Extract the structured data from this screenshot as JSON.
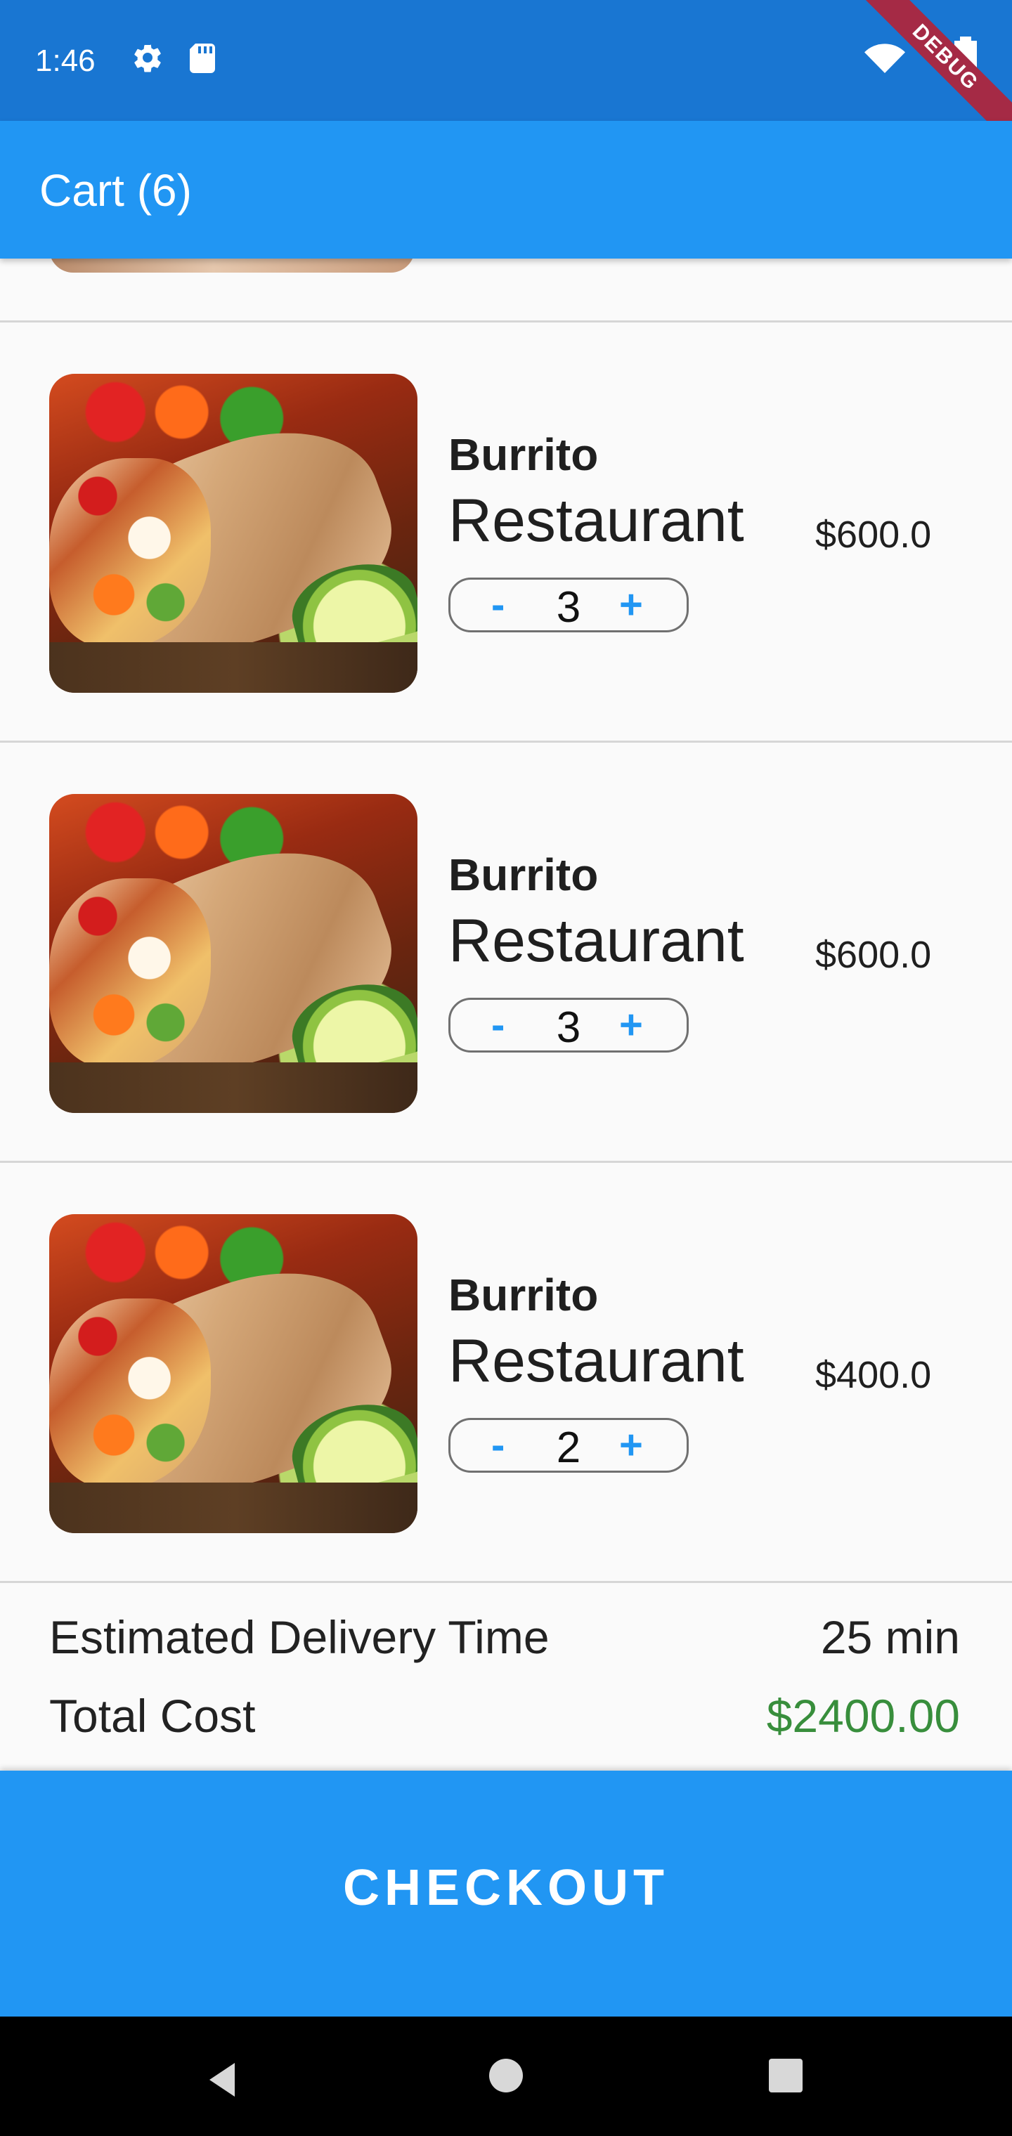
{
  "status_bar": {
    "time": "1:46",
    "debug_label": "DEBUG",
    "icons": [
      "gear-icon",
      "sd-card-icon",
      "wifi-icon",
      "signal-icon",
      "battery-icon"
    ]
  },
  "app_bar": {
    "title": "Cart (6)"
  },
  "cart": {
    "items": [
      {
        "category": "Burrito",
        "restaurant": "Restaurant",
        "price": "$600.0",
        "minus_label": "-",
        "quantity": "3",
        "plus_label": "+"
      },
      {
        "category": "Burrito",
        "restaurant": "Restaurant",
        "price": "$600.0",
        "minus_label": "-",
        "quantity": "3",
        "plus_label": "+"
      },
      {
        "category": "Burrito",
        "restaurant": "Restaurant",
        "price": "$400.0",
        "minus_label": "-",
        "quantity": "2",
        "plus_label": "+"
      }
    ]
  },
  "summary": {
    "delivery_label": "Estimated Delivery Time",
    "delivery_value": "25 min",
    "total_label": "Total Cost",
    "total_value": "$2400.00"
  },
  "checkout": {
    "label": "CHECKOUT"
  },
  "colors": {
    "status_bar": "#1976d2",
    "primary": "#2196f3",
    "total_green": "#388e3c",
    "debug_ribbon": "#a52a45"
  },
  "nav_icons": [
    "back-icon",
    "home-icon",
    "recents-icon"
  ]
}
